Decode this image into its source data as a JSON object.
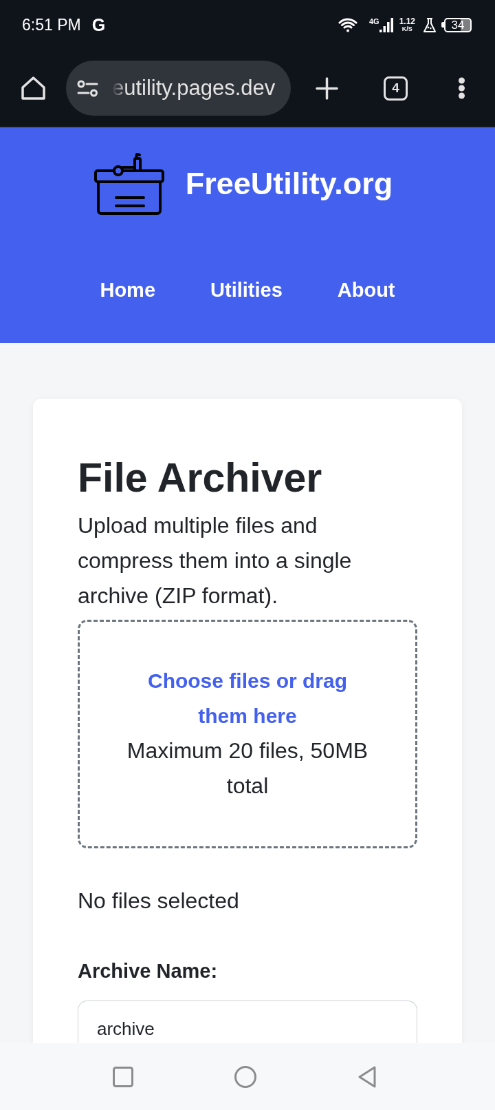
{
  "status_bar": {
    "time": "6:51 PM",
    "notification_glyph": "G",
    "network_type": "4G",
    "data_speed": "1.12",
    "data_speed_unit": "K/S",
    "battery": "34"
  },
  "browser_toolbar": {
    "url": "eutility.pages.dev",
    "tab_count": "4"
  },
  "site_header": {
    "site_name": "FreeUtility.org",
    "nav_links": [
      "Home",
      "Utilities",
      "About"
    ]
  },
  "card": {
    "title": "File Archiver",
    "description": "Upload multiple files and compress them into a single archive (ZIP format).",
    "drop_zone": {
      "link": "Choose files or drag them here",
      "hint": "Maximum 20 files, 50MB total"
    },
    "file_status": "No files selected",
    "archive_name": {
      "label": "Archive Name:",
      "value": "archive"
    }
  }
}
